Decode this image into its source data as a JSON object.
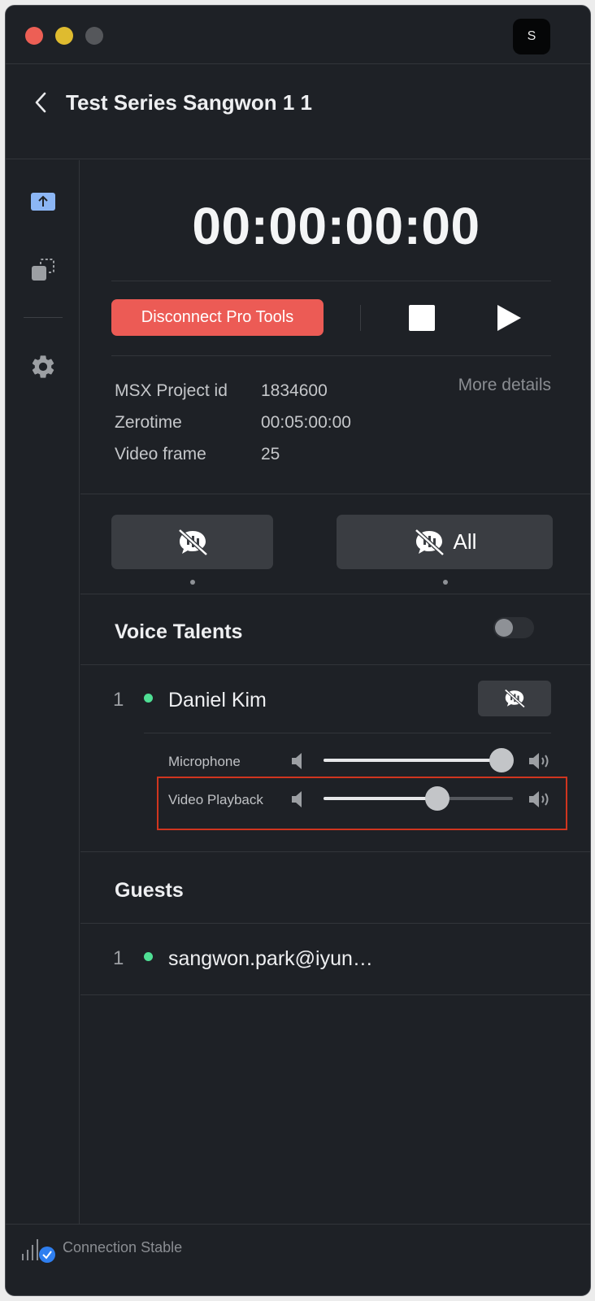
{
  "window": {
    "avatar_letter": "S"
  },
  "header": {
    "title": "Test Series Sangwon 1 1"
  },
  "sidebar": {
    "items": [
      {
        "icon": "upload-icon",
        "active": true
      },
      {
        "icon": "switch-icon",
        "active": false
      },
      {
        "icon": "gear-icon",
        "active": false
      }
    ]
  },
  "transport": {
    "timecode": "00:00:00:00",
    "disconnect_label": "Disconnect Pro Tools"
  },
  "project_info": {
    "rows": [
      {
        "label": "MSX Project id",
        "value": "1834600"
      },
      {
        "label": "Zerotime",
        "value": "00:05:00:00"
      },
      {
        "label": "Video frame",
        "value": "25"
      }
    ],
    "more_details": "More details"
  },
  "mute_controls": {
    "all_label": "All"
  },
  "voice_talents": {
    "title": "Voice Talents",
    "toggle_on": false,
    "items": [
      {
        "number": "1",
        "name": "Daniel Kim",
        "status_color": "#4fdf94",
        "microphone_label": "Microphone",
        "microphone_level": 0.94,
        "video_playback_label": "Video Playback",
        "video_playback_level": 0.6
      }
    ]
  },
  "guests": {
    "title": "Guests",
    "items": [
      {
        "number": "1",
        "name": "sangwon.park@iyun…",
        "status_color": "#4fdf94"
      }
    ]
  },
  "footer": {
    "status": "Connection Stable"
  },
  "colors": {
    "accent_red": "#ec5b55",
    "online_green": "#4fdf94",
    "highlight_red": "#d0351f",
    "active_blue": "#8cb6f5"
  }
}
